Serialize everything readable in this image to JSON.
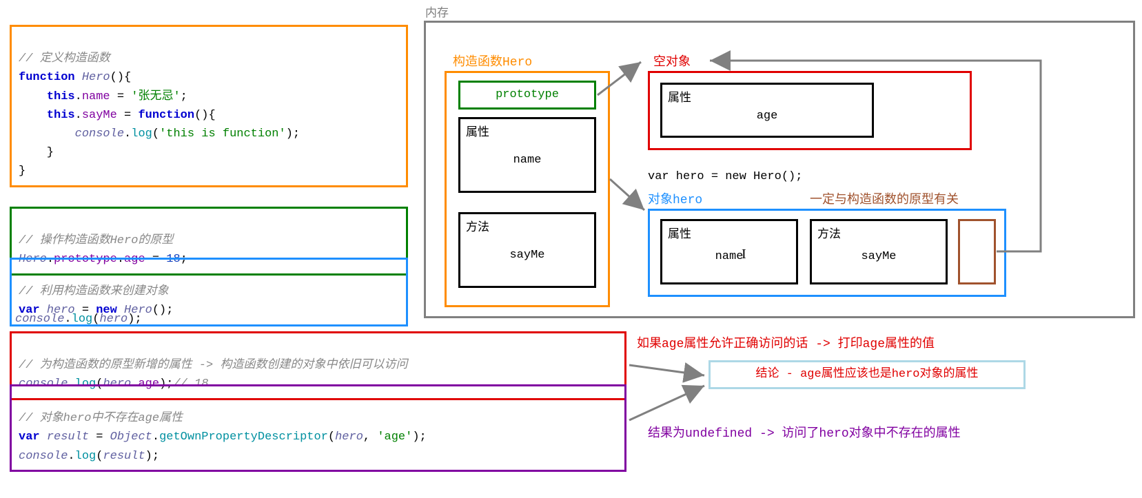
{
  "code": {
    "block1": {
      "comment": "// 定义构造函数",
      "l1a": "function",
      "l1b": "Hero",
      "l1c": "(){",
      "l2a": "this",
      "l2b": ".",
      "l2c": "name",
      "l2d": " = ",
      "l2e": "'张无忌'",
      "l2f": ";",
      "l3a": "this",
      "l3b": ".",
      "l3c": "sayMe",
      "l3d": " = ",
      "l3e": "function",
      "l3f": "(){",
      "l4a": "console",
      "l4b": ".",
      "l4c": "log",
      "l4d": "(",
      "l4e": "'this is function'",
      "l4f": ");",
      "l5": "    }",
      "l6": "}"
    },
    "block2": {
      "comment": "// 操作构造函数Hero的原型",
      "l1a": "Hero",
      "l1b": ".",
      "l1c": "prototype",
      "l1d": ".",
      "l1e": "age",
      "l1f": " = ",
      "l1g": "18",
      "l1h": ";"
    },
    "block3": {
      "comment": "// 利用构造函数来创建对象",
      "l1a": "var",
      "l1b": " ",
      "l1c": "hero",
      "l1d": " = ",
      "l1e": "new",
      "l1f": " ",
      "l1g": "Hero",
      "l1h": "();"
    },
    "line_console_hero": {
      "a": "console",
      "b": ".",
      "c": "log",
      "d": "(",
      "e": "hero",
      "f": ");"
    },
    "block4": {
      "comment": "// 为构造函数的原型新增的属性 -> 构造函数创建的对象中依旧可以访问",
      "l1a": "console",
      "l1b": ".",
      "l1c": "log",
      "l1d": "(",
      "l1e": "hero",
      "l1f": ".",
      "l1g": "age",
      "l1h": ");",
      "l1i": "// 18"
    },
    "block5": {
      "comment": "// 对象hero中不存在age属性",
      "l1a": "var",
      "l1b": " ",
      "l1c": "result",
      "l1d": " = ",
      "l1e": "Object",
      "l1f": ".",
      "l1g": "getOwnPropertyDescriptor",
      "l1h": "(",
      "l1i": "hero",
      "l1j": ", ",
      "l1k": "'age'",
      "l1l": ");",
      "l2a": "console",
      "l2b": ".",
      "l2c": "log",
      "l2d": "(",
      "l2e": "result",
      "l2f": ");"
    }
  },
  "memory": {
    "title": "内存",
    "constructor_label": "构造函数Hero",
    "prototype_box": "prototype",
    "attr_label": "属性",
    "name_text": "name",
    "method_label": "方法",
    "sayme_text": "sayMe",
    "empty_obj": "空对象",
    "age_text": "age",
    "new_hero_code": "var hero = new Hero();",
    "obj_hero_label": "对象hero",
    "proto_relation": "一定与构造函数的原型有关"
  },
  "annotations": {
    "red_note": "如果age属性允许正确访问的话 -> 打印age属性的值",
    "conclusion": "结论 - age属性应该也是hero对象的属性",
    "purple_note": "结果为undefined -> 访问了hero对象中不存在的属性"
  }
}
